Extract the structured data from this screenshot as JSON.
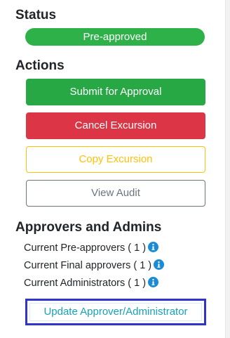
{
  "status": {
    "heading": "Status",
    "value": "Pre-approved",
    "color": "#2fb14a"
  },
  "actions": {
    "heading": "Actions",
    "submit_label": "Submit for Approval",
    "cancel_label": "Cancel Excursion",
    "copy_label": "Copy Excursion",
    "audit_label": "View Audit"
  },
  "approvers": {
    "heading": "Approvers and Admins",
    "items": [
      {
        "label": "Current Pre-approvers ( 1 )",
        "icon": "info-icon"
      },
      {
        "label": "Current Final approvers ( 1 )",
        "icon": "info-icon"
      },
      {
        "label": "Current Administrators ( 1 )",
        "icon": "info-icon"
      }
    ],
    "update_label": "Update Approver/Administrator"
  },
  "colors": {
    "success": "#28a745",
    "danger": "#dc3545",
    "warning": "#ffc107",
    "secondary": "#6c757d",
    "info": "#17a2b8",
    "info_icon": "#1a8bd6",
    "highlight": "#2f35c8"
  }
}
